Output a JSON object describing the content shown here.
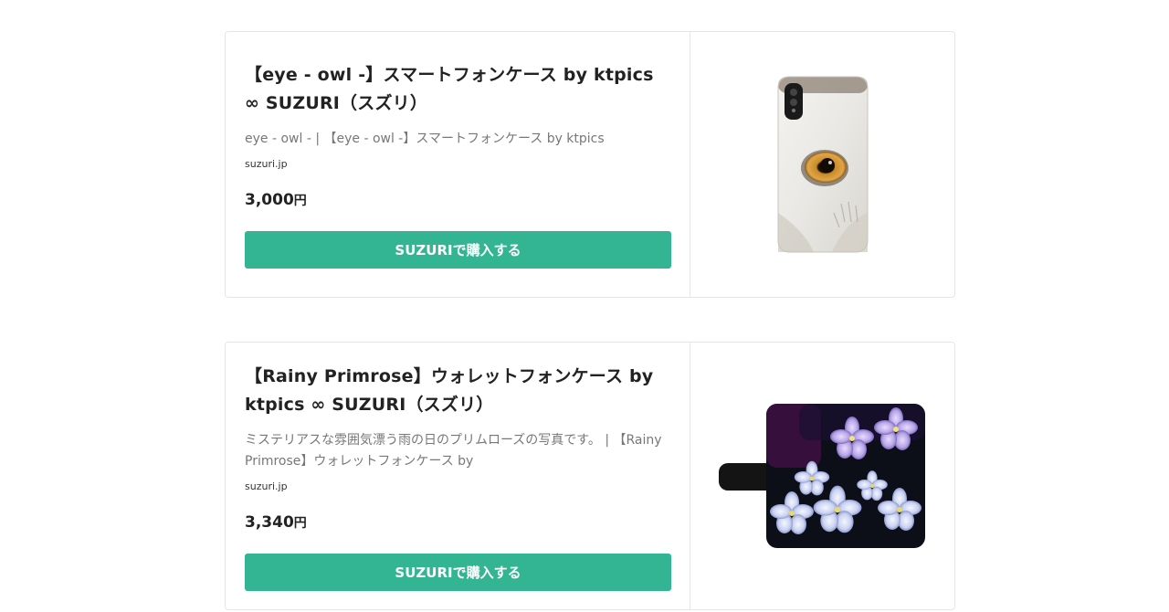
{
  "cards": [
    {
      "title": "【eye - owl -】スマートフォンケース by ktpics ∞ SUZURI（スズリ）",
      "description": "eye - owl - | 【eye - owl -】スマートフォンケース by ktpics",
      "domain": "suzuri.jp",
      "price": "3,000",
      "currency": "円",
      "button_label": "SUZURIで購入する",
      "image_icon": "owl-eye-phone-case-image"
    },
    {
      "title": "【Rainy Primrose】ウォレットフォンケース by ktpics ∞ SUZURI（スズリ）",
      "description": "ミステリアスな雰囲気漂う雨の日のプリムローズの写真です。 | 【Rainy Primrose】ウォレットフォンケース by",
      "domain": "suzuri.jp",
      "price": "3,340",
      "currency": "円",
      "button_label": "SUZURIで購入する",
      "image_icon": "primrose-wallet-case-image"
    }
  ],
  "colors": {
    "button": "#33b593",
    "border": "#e6e6e6",
    "title": "#222222",
    "description": "#777777"
  }
}
